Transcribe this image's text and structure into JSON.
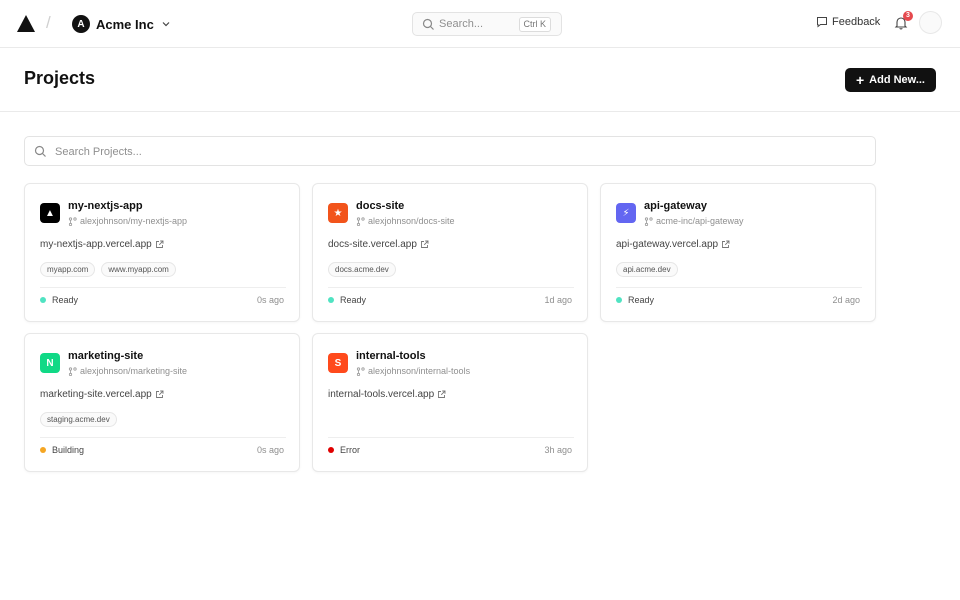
{
  "nav": {
    "team_initial": "A",
    "team_name": "Acme Inc",
    "search_placeholder": "Search...",
    "search_shortcut": "Ctrl K",
    "feedback_label": "Feedback",
    "notification_count": "3"
  },
  "header": {
    "title": "Projects",
    "add_button_label": "Add New..."
  },
  "project_search": {
    "placeholder": "Search Projects..."
  },
  "projects": [
    {
      "name": "my-nextjs-app",
      "icon_glyph": "▲",
      "icon_name": "nextjs-triangle-icon",
      "icon_color": "#000000",
      "repo": "alexjohnson/my-nextjs-app",
      "url": "my-nextjs-app.vercel.app",
      "domains": [
        "myapp.com",
        "www.myapp.com"
      ],
      "status": "Ready",
      "status_color": "#50e3c2",
      "time": "0s ago"
    },
    {
      "name": "docs-site",
      "icon_glyph": "★",
      "icon_name": "star-icon",
      "icon_color": "#f2541b",
      "repo": "alexjohnson/docs-site",
      "url": "docs-site.vercel.app",
      "domains": [
        "docs.acme.dev"
      ],
      "status": "Ready",
      "status_color": "#50e3c2",
      "time": "1d ago"
    },
    {
      "name": "api-gateway",
      "icon_glyph": "⚡",
      "icon_name": "lightning-icon",
      "icon_color": "#6366f1",
      "repo": "acme-inc/api-gateway",
      "url": "api-gateway.vercel.app",
      "domains": [
        "api.acme.dev"
      ],
      "status": "Ready",
      "status_color": "#50e3c2",
      "time": "2d ago"
    },
    {
      "name": "marketing-site",
      "icon_glyph": "N",
      "icon_name": "letter-n-icon",
      "icon_color": "#10d986",
      "repo": "alexjohnson/marketing-site",
      "url": "marketing-site.vercel.app",
      "domains": [
        "staging.acme.dev"
      ],
      "status": "Building",
      "status_color": "#f5a623",
      "time": "0s ago"
    },
    {
      "name": "internal-tools",
      "icon_glyph": "S",
      "icon_name": "letter-s-icon",
      "icon_color": "#ff4a1c",
      "repo": "alexjohnson/internal-tools",
      "url": "internal-tools.vercel.app",
      "domains": [],
      "status": "Error",
      "status_color": "#e00000",
      "time": "3h ago"
    }
  ]
}
